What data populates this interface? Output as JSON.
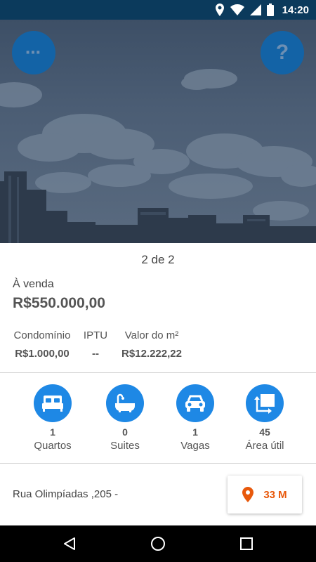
{
  "status_bar": {
    "time": "14:20"
  },
  "hero": {
    "menu_glyph": "⋯",
    "help_glyph": "?"
  },
  "pager": "2 de 2",
  "listing": {
    "status": "À venda",
    "price": "R$550.000,00",
    "fees": [
      {
        "label": "Condomínio",
        "value": "R$1.000,00"
      },
      {
        "label": "IPTU",
        "value": "--"
      },
      {
        "label": "Valor do m²",
        "value": "R$12.222,22"
      }
    ],
    "features": [
      {
        "icon": "bed-icon",
        "count": "1",
        "label": "Quartos"
      },
      {
        "icon": "bathtub-icon",
        "count": "0",
        "label": "Suites"
      },
      {
        "icon": "car-icon",
        "count": "1",
        "label": "Vagas"
      },
      {
        "icon": "area-icon",
        "count": "45",
        "label": "Área útil"
      }
    ],
    "address": "Rua Olimpíadas ,205 -",
    "distance": "33 M"
  },
  "colors": {
    "status_bar": "#0b3a5c",
    "accent_blue": "#1e88e5",
    "fab_blue": "#1363a6",
    "distance_orange": "#e8590c"
  }
}
